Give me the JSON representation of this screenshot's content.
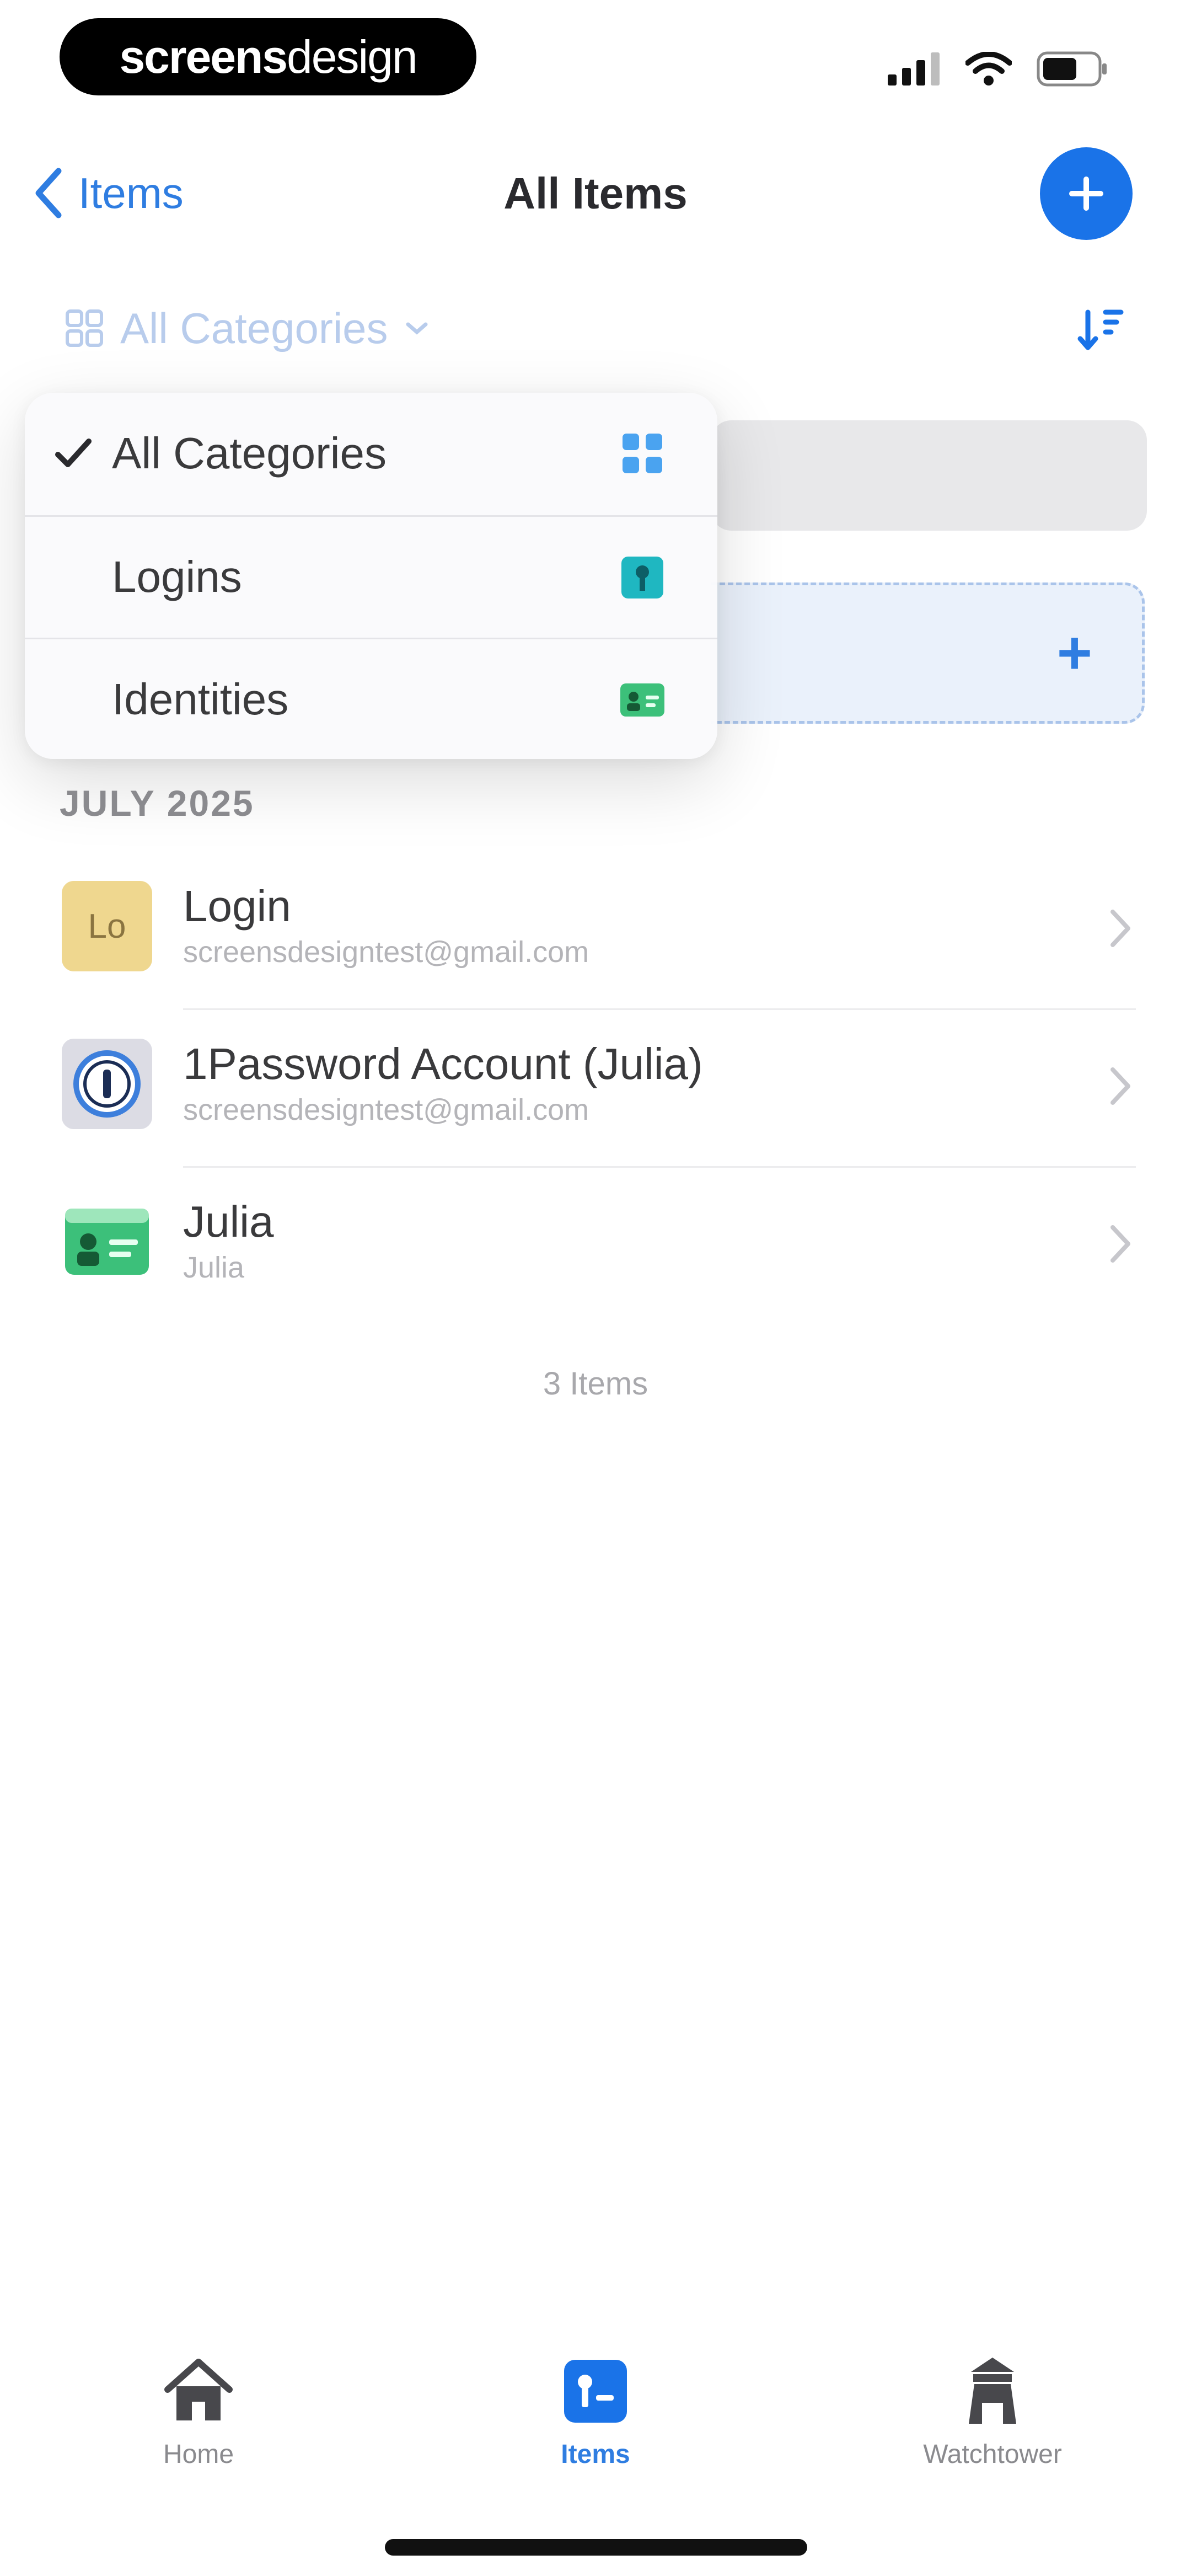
{
  "status_bar": {
    "brand_bold": "screens",
    "brand_thin": "design"
  },
  "nav": {
    "back_label": "Items",
    "title": "All Items"
  },
  "filter": {
    "current": "All Categories"
  },
  "dropdown": {
    "items": [
      {
        "label": "All Categories",
        "selected": true,
        "icon": "grid-icon",
        "color": "#4aa3f0"
      },
      {
        "label": "Logins",
        "selected": false,
        "icon": "login-key-icon",
        "color": "#1fb7c1"
      },
      {
        "label": "Identities",
        "selected": false,
        "icon": "identity-card-icon",
        "color": "#3cc07a"
      }
    ]
  },
  "list": {
    "section_header": "JULY 2025",
    "rows": [
      {
        "title": "Login",
        "subtitle": "screensdesigntest@gmail.com",
        "thumb_text": "Lo",
        "thumb_color": "#efd78f"
      },
      {
        "title": "1Password Account (Julia)",
        "subtitle": "screensdesigntest@gmail.com",
        "thumb_color": "#dcdce4"
      },
      {
        "title": "Julia",
        "subtitle": "Julia",
        "thumb_color": "#3cc07a"
      }
    ],
    "count_label": "3 Items"
  },
  "tabs": [
    {
      "label": "Home",
      "icon": "home-icon",
      "active": false
    },
    {
      "label": "Items",
      "icon": "items-icon",
      "active": true
    },
    {
      "label": "Watchtower",
      "icon": "watchtower-icon",
      "active": false
    }
  ],
  "colors": {
    "accent": "#1a73e8",
    "link": "#2f7de1"
  }
}
